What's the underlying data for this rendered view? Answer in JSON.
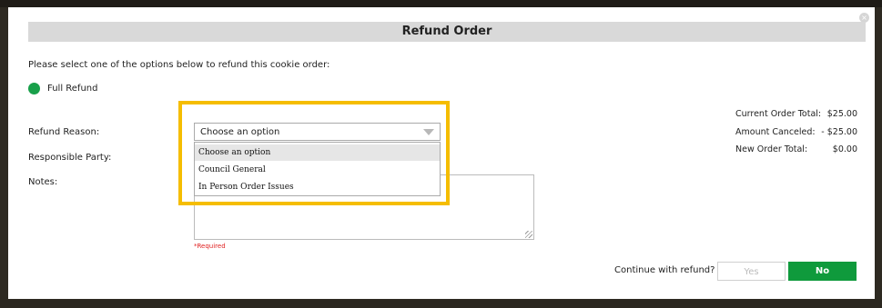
{
  "dialog": {
    "title": "Refund Order",
    "instruction": "Please select one of the options below to refund this cookie order:",
    "close_icon": "×"
  },
  "refund_option": {
    "label": "Full Refund",
    "selected": true,
    "color": "#18a04a"
  },
  "form": {
    "refund_reason_label": "Refund Reason:",
    "responsible_party_label": "Responsible Party:",
    "notes_label": "Notes:",
    "refund_reason_value": "Choose an option",
    "refund_reason_options": [
      "Choose an option",
      "Council General",
      "In Person Order Issues"
    ],
    "notes_value": "",
    "required_text": "*Required"
  },
  "summary": {
    "current_order_total_label": "Current Order Total:",
    "current_order_total_value": "$25.00",
    "amount_canceled_label": "Amount Canceled:",
    "amount_canceled_value": "- $25.00",
    "new_order_total_label": "New Order Total:",
    "new_order_total_value": "$0.00"
  },
  "actions": {
    "prompt": "Continue with refund?",
    "yes_label": "Yes",
    "no_label": "No"
  },
  "colors": {
    "highlight": "#f5bd00",
    "primary_button": "#0f9a3c",
    "required": "#e02020"
  }
}
